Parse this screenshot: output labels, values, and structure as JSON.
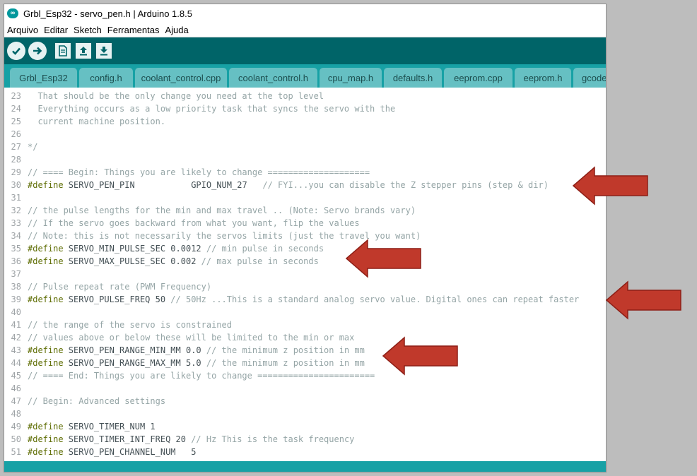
{
  "window": {
    "title": "Grbl_Esp32 - servo_pen.h | Arduino 1.8.5"
  },
  "menu": [
    "Arquivo",
    "Editar",
    "Sketch",
    "Ferramentas",
    "Ajuda"
  ],
  "toolbar": [
    {
      "name": "verify-button",
      "icon": "checkmark-icon"
    },
    {
      "name": "upload-button",
      "icon": "right-arrow-icon"
    },
    {
      "name": "new-button",
      "icon": "new-file-icon"
    },
    {
      "name": "open-button",
      "icon": "up-arrow-icon"
    },
    {
      "name": "save-button",
      "icon": "down-arrow-icon"
    }
  ],
  "tabs": [
    {
      "label": "Grbl_Esp32",
      "active": false
    },
    {
      "label": "config.h",
      "active": false
    },
    {
      "label": "coolant_control.cpp",
      "active": false
    },
    {
      "label": "coolant_control.h",
      "active": false
    },
    {
      "label": "cpu_map.h",
      "active": false
    },
    {
      "label": "defaults.h",
      "active": false
    },
    {
      "label": "eeprom.cpp",
      "active": false
    },
    {
      "label": "eeprom.h",
      "active": false
    },
    {
      "label": "gcode",
      "active": false
    }
  ],
  "code": [
    {
      "n": "23",
      "parts": [
        [
          "cm",
          "  That should be the only change you need at the top level"
        ]
      ]
    },
    {
      "n": "24",
      "parts": [
        [
          "cm",
          "  Everything occurs as a low priority task that syncs the servo with the"
        ]
      ]
    },
    {
      "n": "25",
      "parts": [
        [
          "cm",
          "  current machine position."
        ]
      ]
    },
    {
      "n": "26",
      "parts": []
    },
    {
      "n": "27",
      "parts": [
        [
          "cm",
          "*/"
        ]
      ]
    },
    {
      "n": "28",
      "parts": []
    },
    {
      "n": "29",
      "parts": [
        [
          "cm",
          "// ==== Begin: Things you are likely to change ===================="
        ]
      ]
    },
    {
      "n": "30",
      "parts": [
        [
          "pp",
          "#define"
        ],
        [
          "tx",
          " SERVO_PEN_PIN           GPIO_NUM_27   "
        ],
        [
          "cm",
          "// FYI...you can disable the Z stepper pins (step & dir)"
        ]
      ]
    },
    {
      "n": "31",
      "parts": []
    },
    {
      "n": "32",
      "parts": [
        [
          "cm",
          "// the pulse lengths for the min and max travel .. (Note: Servo brands vary)"
        ]
      ]
    },
    {
      "n": "33",
      "parts": [
        [
          "cm",
          "// If the servo goes backward from what you want, flip the values"
        ]
      ]
    },
    {
      "n": "34",
      "parts": [
        [
          "cm",
          "// Note: this is not necessarily the servos limits (just the travel you want)"
        ]
      ]
    },
    {
      "n": "35",
      "parts": [
        [
          "pp",
          "#define"
        ],
        [
          "tx",
          " SERVO_MIN_PULSE_SEC 0.0012 "
        ],
        [
          "cm",
          "// min pulse in seconds"
        ]
      ]
    },
    {
      "n": "36",
      "parts": [
        [
          "pp",
          "#define"
        ],
        [
          "tx",
          " SERVO_MAX_PULSE_SEC 0.002 "
        ],
        [
          "cm",
          "// max pulse in seconds"
        ]
      ]
    },
    {
      "n": "37",
      "parts": []
    },
    {
      "n": "38",
      "parts": [
        [
          "cm",
          "// Pulse repeat rate (PWM Frequency)"
        ]
      ]
    },
    {
      "n": "39",
      "parts": [
        [
          "pp",
          "#define"
        ],
        [
          "tx",
          " SERVO_PULSE_FREQ 50 "
        ],
        [
          "cm",
          "// 50Hz ...This is a standard analog servo value. Digital ones can repeat faster"
        ]
      ]
    },
    {
      "n": "40",
      "parts": []
    },
    {
      "n": "41",
      "parts": [
        [
          "cm",
          "// the range of the servo is constrained"
        ]
      ]
    },
    {
      "n": "42",
      "parts": [
        [
          "cm",
          "// values above or below these will be limited to the min or max"
        ]
      ]
    },
    {
      "n": "43",
      "parts": [
        [
          "pp",
          "#define"
        ],
        [
          "tx",
          " SERVO_PEN_RANGE_MIN_MM 0.0 "
        ],
        [
          "cm",
          "// the minimum z position in mm"
        ]
      ]
    },
    {
      "n": "44",
      "parts": [
        [
          "pp",
          "#define"
        ],
        [
          "tx",
          " SERVO_PEN_RANGE_MAX_MM 5.0 "
        ],
        [
          "cm",
          "// the minimum z position in mm"
        ]
      ]
    },
    {
      "n": "45",
      "parts": [
        [
          "cm",
          "// ==== End: Things you are likely to change ======================="
        ]
      ]
    },
    {
      "n": "46",
      "parts": []
    },
    {
      "n": "47",
      "parts": [
        [
          "cm",
          "// Begin: Advanced settings"
        ]
      ]
    },
    {
      "n": "48",
      "parts": []
    },
    {
      "n": "49",
      "parts": [
        [
          "pp",
          "#define"
        ],
        [
          "tx",
          " SERVO_TIMER_NUM 1"
        ]
      ]
    },
    {
      "n": "50",
      "parts": [
        [
          "pp",
          "#define"
        ],
        [
          "tx",
          " SERVO_TIMER_INT_FREQ 20 "
        ],
        [
          "cm",
          "// Hz This is the task frequency"
        ]
      ]
    },
    {
      "n": "51",
      "parts": [
        [
          "pp",
          "#define"
        ],
        [
          "tx",
          " SERVO_PEN_CHANNEL_NUM   5"
        ]
      ]
    }
  ],
  "colors": {
    "toolbar": "#006468",
    "tabbar": "#17a1a5",
    "tab": "#66c0c3",
    "preprocessor": "#5e6d03",
    "comment": "#95a5a6",
    "arrow": "#c0392b"
  }
}
